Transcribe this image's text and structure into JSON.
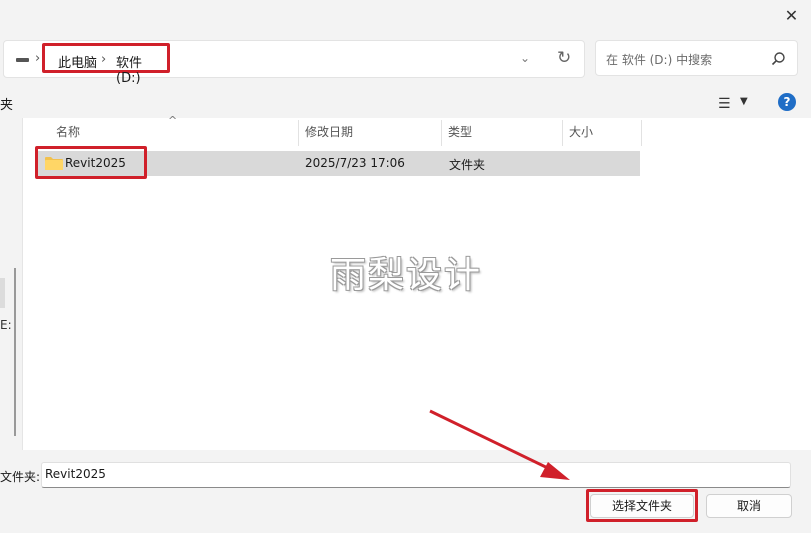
{
  "address": {
    "crumbs": [
      "此电脑",
      "软件 (D:)"
    ],
    "separator": "›"
  },
  "search": {
    "placeholder": "在 软件 (D:) 中搜索"
  },
  "toolbar": {
    "left_fragment": "夹"
  },
  "nav": {
    "fragment": "E:"
  },
  "columns": [
    {
      "label": "名称"
    },
    {
      "label": "修改日期"
    },
    {
      "label": "类型"
    },
    {
      "label": "大小"
    }
  ],
  "files": [
    {
      "name": "Revit2025",
      "modified": "2025/7/23 17:06",
      "type": "文件夹",
      "size": ""
    }
  ],
  "watermark": "雨梨设计",
  "footer": {
    "folder_label": "文件夹:",
    "folder_value": "Revit2025",
    "select_button": "选择文件夹",
    "cancel_button": "取消"
  },
  "window": {
    "close_glyph": "✕"
  },
  "annotation_color": "#d0202a",
  "icons": {
    "drive": "drive-icon",
    "refresh": "refresh-icon",
    "search": "search-icon",
    "view": "view-options-icon",
    "help": "help-icon",
    "folder": "folder-icon"
  }
}
